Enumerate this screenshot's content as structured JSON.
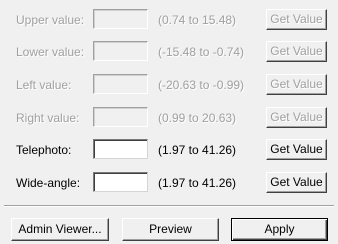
{
  "rows": [
    {
      "label": "Upper value:",
      "value": "",
      "range": "(0.74 to 15.48)",
      "button": "Get Value",
      "enabled": false
    },
    {
      "label": "Lower value:",
      "value": "",
      "range": "(-15.48 to -0.74)",
      "button": "Get Value",
      "enabled": false
    },
    {
      "label": "Left value:",
      "value": "",
      "range": "(-20.63 to -0.99)",
      "button": "Get Value",
      "enabled": false
    },
    {
      "label": "Right value:",
      "value": "",
      "range": "(0.99 to 20.63)",
      "button": "Get Value",
      "enabled": false
    },
    {
      "label": "Telephoto:",
      "value": "",
      "range": "(1.97 to 41.26)",
      "button": "Get Value",
      "enabled": true
    },
    {
      "label": "Wide-angle:",
      "value": "",
      "range": "(1.97 to 41.26)",
      "button": "Get Value",
      "enabled": true
    }
  ],
  "footer": {
    "admin_viewer_label": "Admin Viewer...",
    "preview_label": "Preview",
    "apply_label": "Apply"
  },
  "colors": {
    "background": "#f0f0f0",
    "disabled_text": "#a0a0a0",
    "field_background": "#ffffff"
  }
}
